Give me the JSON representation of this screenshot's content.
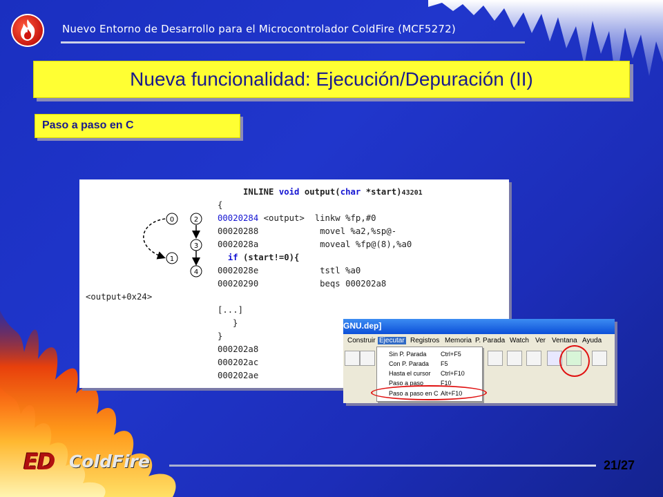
{
  "header": {
    "title": "Nuevo Entorno de Desarrollo para el Microcontrolador ColdFire (MCF5272)",
    "logo_icon": "flame-icon"
  },
  "slide": {
    "title": "Nueva funcionalidad: Ejecución/Depuración (II)",
    "subtitle": "Paso a paso en C",
    "page_number": "21/27"
  },
  "code": {
    "lines": [
      {
        "c1": "INLINE ",
        "kw1": "void",
        "c2": " output(",
        "kw2": "char",
        "c3": " *start)",
        "num": "43201"
      },
      {
        "text": "{"
      },
      {
        "addr": "00020284",
        "label": "<output>",
        "instr": "linkw %fp,#0"
      },
      {
        "addr": "00020288",
        "instr": "movel %a2,%sp@-"
      },
      {
        "addr": "0002028a",
        "instr": "moveal %fp@(8),%a0"
      },
      {
        "kw": "if",
        "rest": " (start!=0){"
      },
      {
        "addr": "0002028e",
        "instr": "tstl %a0"
      },
      {
        "addr": "00020290",
        "instr": "beqs 000202a8"
      },
      {
        "text": "<output+0x24>"
      },
      {
        "text": "[...]"
      },
      {
        "text": "}"
      },
      {
        "text": "}"
      },
      {
        "text": "000202a8"
      },
      {
        "text": "000202ac"
      },
      {
        "text": "000202ae"
      }
    ]
  },
  "graph": {
    "nodes": [
      "0",
      "1",
      "2",
      "3",
      "4"
    ]
  },
  "ide": {
    "title": "GNU.dep]",
    "menu": [
      "Construir",
      "Ejecutar",
      "Registros",
      "Memoria",
      "P. Parada",
      "Watch",
      "Ver",
      "Ventana",
      "Ayuda"
    ],
    "dropdown": [
      {
        "label": "Sin P. Parada",
        "shortcut": "Ctrl+F5"
      },
      {
        "label": "Con P. Parada",
        "shortcut": "F5"
      },
      {
        "label": "Hasta el cursor",
        "shortcut": "Ctrl+F10"
      },
      {
        "label": "Paso a paso",
        "shortcut": "F10"
      },
      {
        "label": "Paso a paso en C",
        "shortcut": "Alt+F10"
      }
    ]
  },
  "footer": {
    "logo_left": "ED",
    "logo_right": "ColdFire"
  }
}
